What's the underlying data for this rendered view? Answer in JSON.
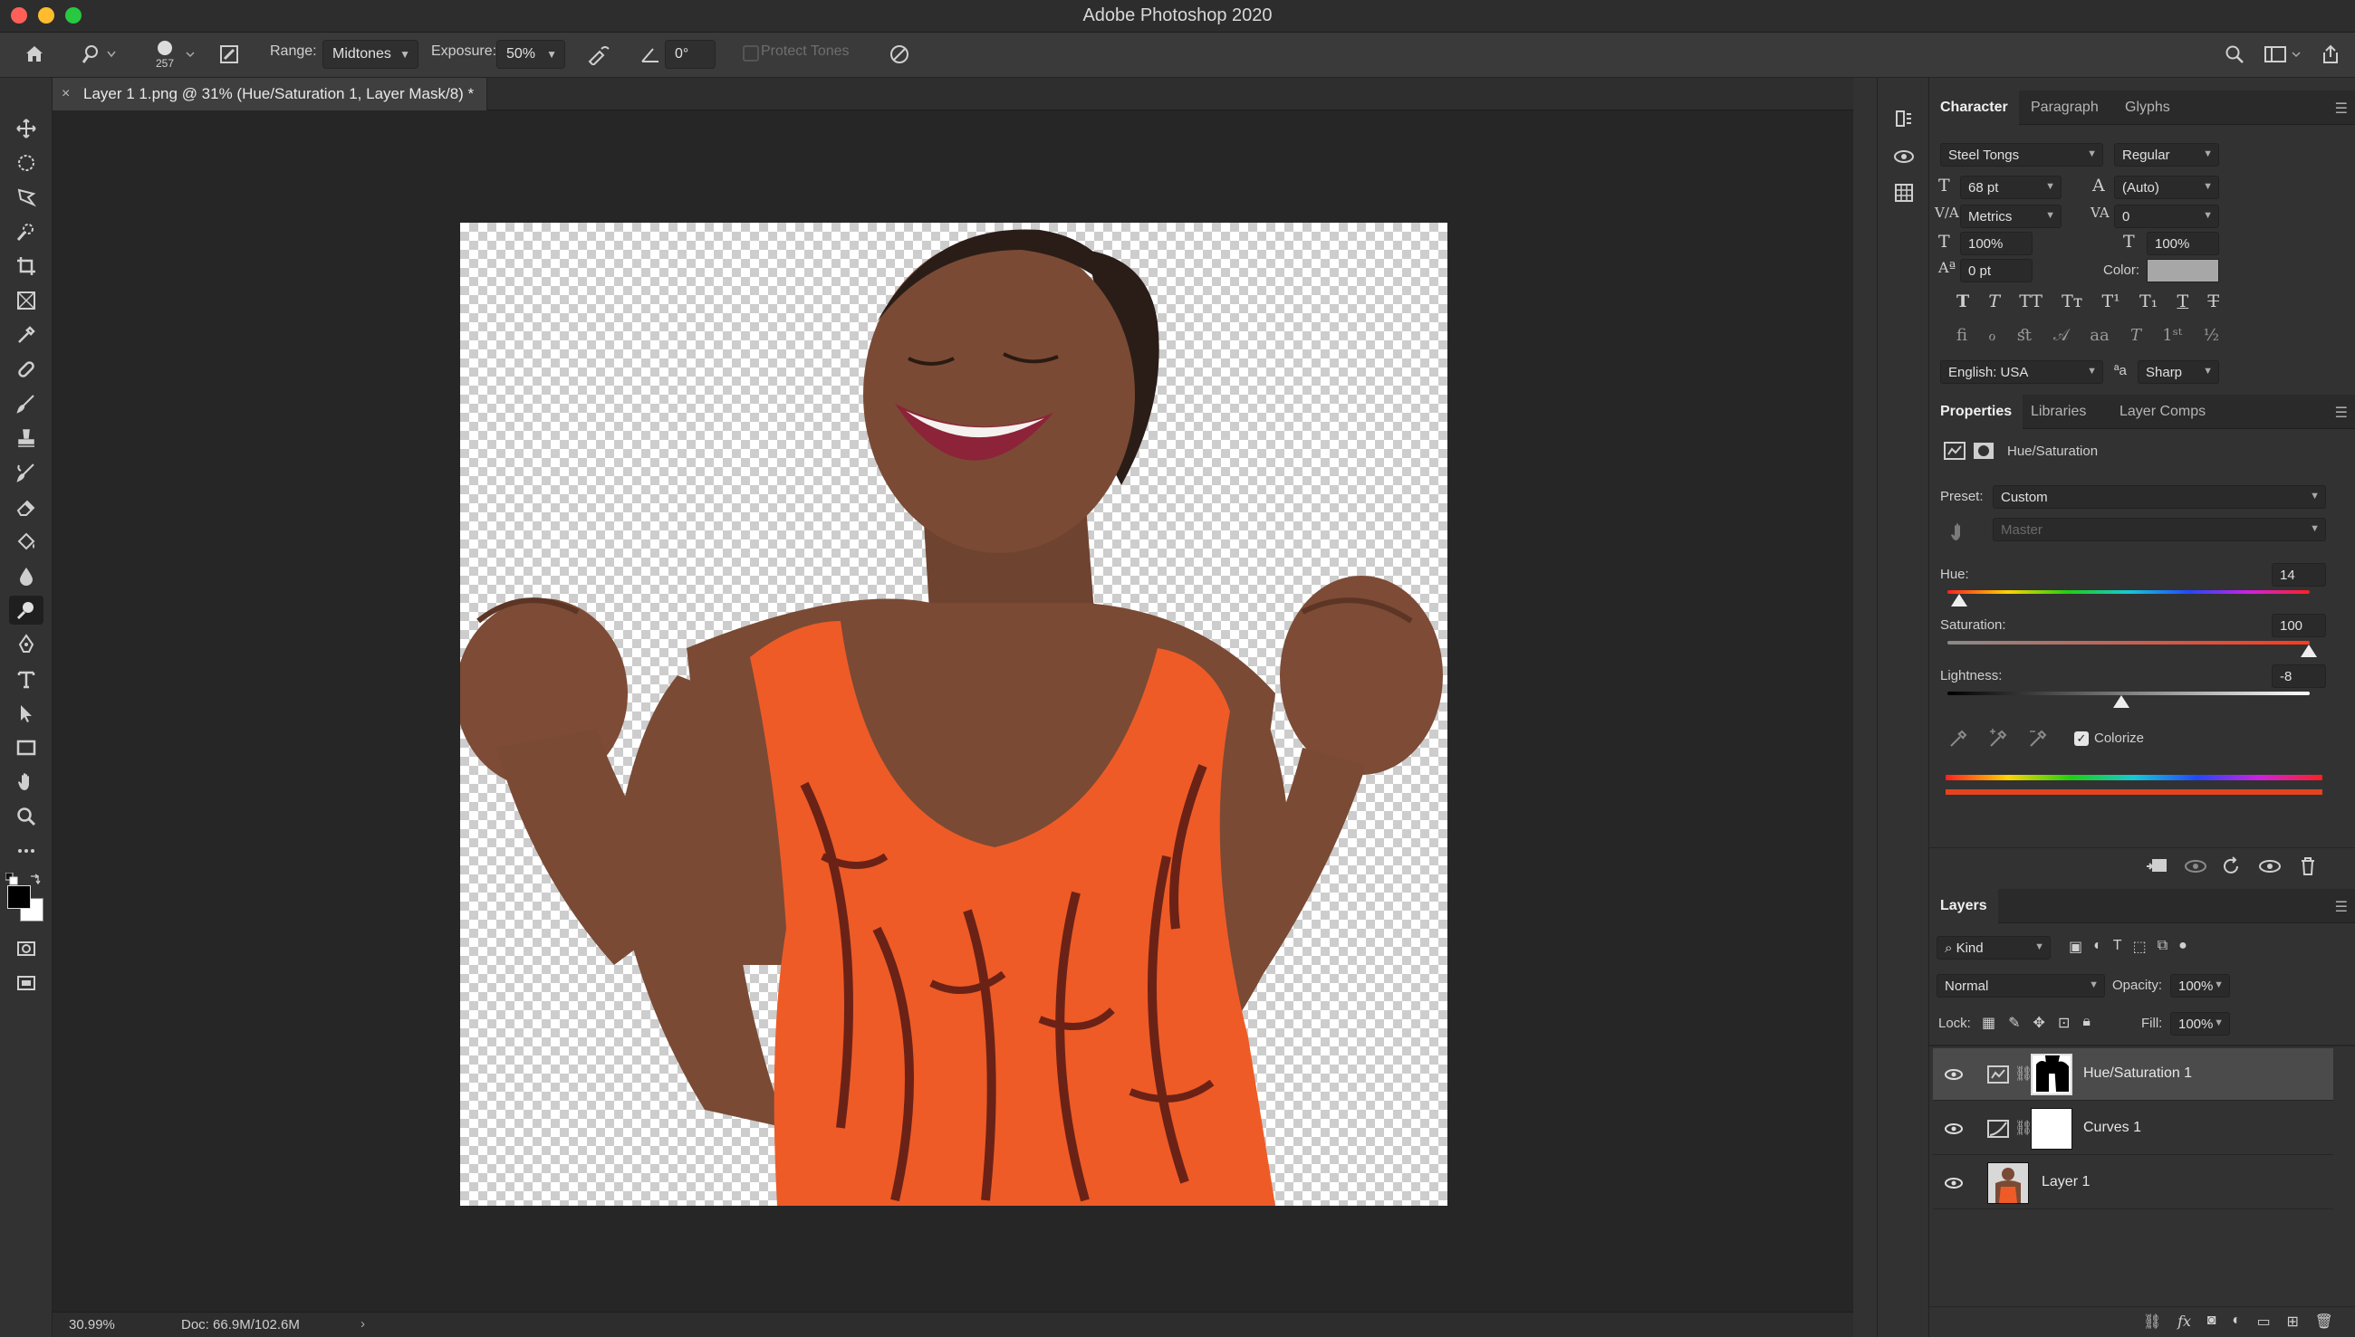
{
  "window": {
    "title": "Adobe Photoshop 2020"
  },
  "options_bar": {
    "brush_size": "257",
    "range_label": "Range:",
    "range_value": "Midtones",
    "exposure_label": "Exposure:",
    "exposure_value": "50%",
    "angle_value": "0°",
    "protect_tones_label": "Protect Tones"
  },
  "document": {
    "tab_title": "Layer 1 1.png @ 31% (Hue/Saturation 1, Layer Mask/8) *",
    "zoom": "30.99%",
    "doc_size": "Doc: 66.9M/102.6M"
  },
  "character_panel": {
    "tabs": [
      "Character",
      "Paragraph",
      "Glyphs"
    ],
    "font_family": "Steel Tongs",
    "font_style": "Regular",
    "font_size": "68 pt",
    "leading": "(Auto)",
    "kerning": "Metrics",
    "tracking": "0",
    "vertical_scale": "100%",
    "horizontal_scale": "100%",
    "baseline_shift": "0 pt",
    "color_label": "Color:",
    "language": "English: USA",
    "antialias": "Sharp",
    "color_swatch": "#a7a7a7"
  },
  "properties_panel": {
    "tabs": [
      "Properties",
      "Libraries",
      "Layer Comps"
    ],
    "adjustment_name": "Hue/Saturation",
    "preset_label": "Preset:",
    "preset_value": "Custom",
    "channel_value": "Master",
    "hue_label": "Hue:",
    "hue_value": "14",
    "saturation_label": "Saturation:",
    "saturation_value": "100",
    "lightness_label": "Lightness:",
    "lightness_value": "-8",
    "colorize_label": "Colorize",
    "colorize_checked": true
  },
  "layers_panel": {
    "title": "Layers",
    "filter_kind": "Kind",
    "blend_mode": "Normal",
    "opacity_label": "Opacity:",
    "opacity_value": "100%",
    "lock_label": "Lock:",
    "fill_label": "Fill:",
    "fill_value": "100%",
    "layers": [
      {
        "name": "Hue/Saturation 1",
        "selected": true
      },
      {
        "name": "Curves 1",
        "selected": false
      },
      {
        "name": "Layer 1",
        "selected": false
      }
    ]
  }
}
